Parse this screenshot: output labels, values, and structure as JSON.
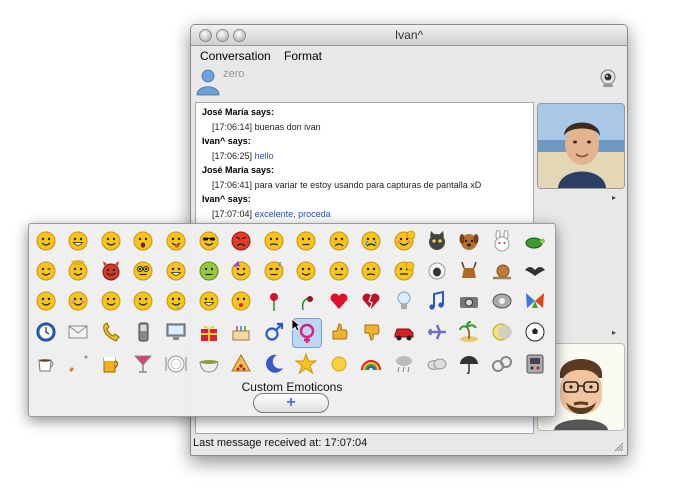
{
  "window": {
    "title": "Ivan^"
  },
  "menu": [
    "Conversation",
    "Format"
  ],
  "buddy": {
    "status": "zero",
    "icon": "buddy-person-icon"
  },
  "chat": [
    {
      "type": "sender",
      "text": "José María says:"
    },
    {
      "type": "message",
      "time": "[17:06:14]",
      "text": "buenas don ivan",
      "color": "#222222"
    },
    {
      "type": "sender",
      "text": "Ivan^ says:"
    },
    {
      "type": "message",
      "time": "[17:06:25]",
      "text": "hello",
      "color": "#2255aa"
    },
    {
      "type": "sender",
      "text": "José María says:"
    },
    {
      "type": "message",
      "time": "[17:06:41]",
      "text": "para variar te estoy usando para capturas de pantalla xD",
      "color": "#222222"
    },
    {
      "type": "sender",
      "text": "Ivan^ says:"
    },
    {
      "type": "message",
      "time": "[17:07:04]",
      "text": "excelente, proceda",
      "color": "#2255aa"
    }
  ],
  "status_bar": "Last message received at: 17:07:04",
  "emoticons": {
    "rows": [
      [
        "smile",
        "grin",
        "happy",
        "surprised",
        "tongue-out",
        "sunglasses",
        "angry",
        "confused",
        "neutral",
        "sad",
        "crying",
        "embarrassed",
        "cat",
        "dog",
        "bunny",
        "turtle"
      ],
      [
        "wink",
        "angel",
        "devil",
        "nerd",
        "teeth",
        "sick",
        "party",
        "sleepy",
        "thinking",
        "shush",
        "sarcastic",
        "secret",
        "sheep",
        "goat",
        "snail",
        "bat"
      ],
      [
        "laugh",
        "blush",
        "eyeroll",
        "shifty",
        "drool",
        "rolling",
        "kiss",
        "rose",
        "wilted-rose",
        "heart",
        "broken-heart",
        "lightbulb",
        "music-note",
        "camera",
        "film",
        "butterfly"
      ],
      [
        "clock",
        "envelope",
        "phone",
        "mobile",
        "computer",
        "gift",
        "cake",
        "boy",
        "girl",
        "thumbs-up",
        "thumbs-down",
        "car",
        "plane",
        "island",
        "moon-eclipse",
        "soccer-ball"
      ],
      [
        "coffee",
        "cigarette",
        "beer",
        "cocktail",
        "plate",
        "bowl",
        "pizza",
        "moon",
        "star",
        "sun",
        "rainbow",
        "rain",
        "cloud",
        "umbrella",
        "handcuffs",
        "gamepad"
      ]
    ],
    "selected": "girl",
    "custom_label": "Custom Emoticons",
    "add_button": "+"
  },
  "colors": {
    "accent": "#3f78d8",
    "face": "#f5c51e",
    "selection": "#bcd6f4"
  }
}
